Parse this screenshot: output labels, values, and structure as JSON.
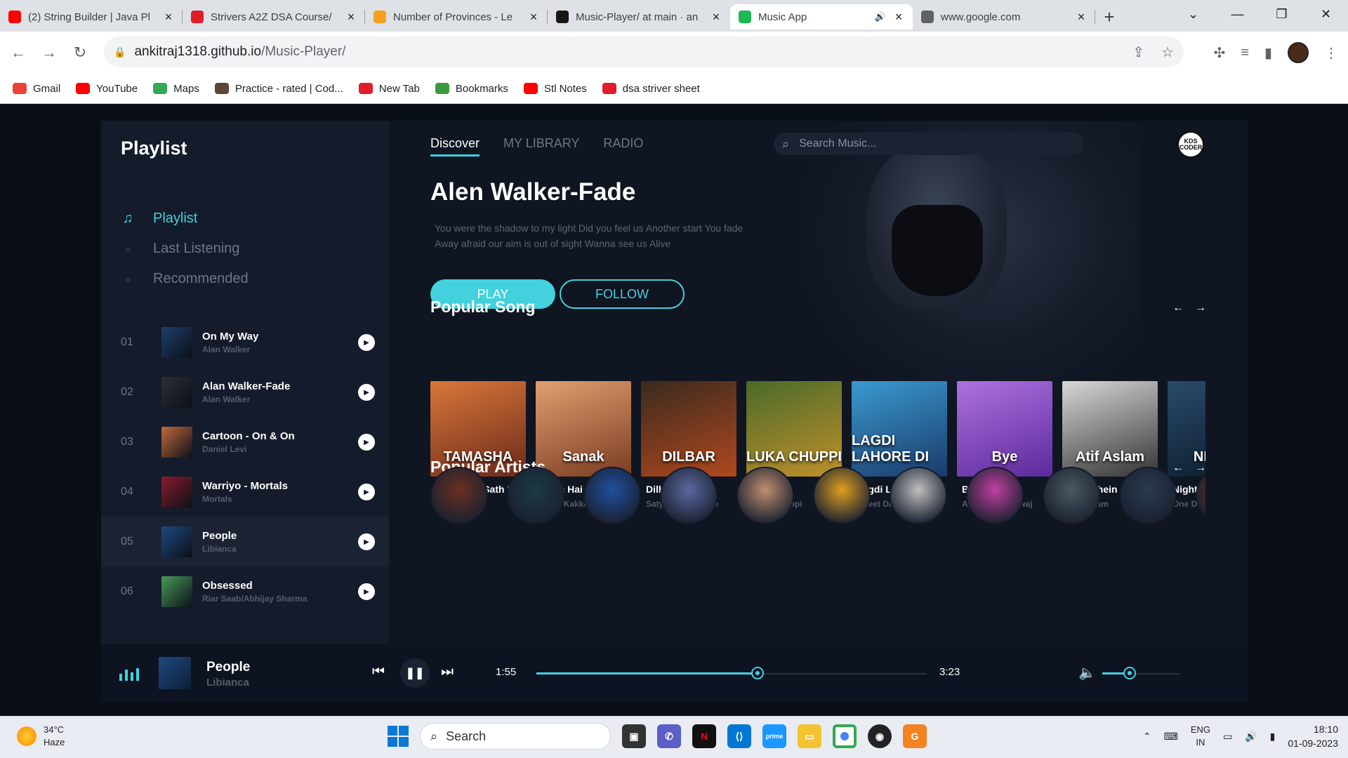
{
  "browser": {
    "tabs": [
      {
        "title": "(2) String Builder | Java Pl",
        "favicon": "youtube-icon",
        "color": "#ff0000",
        "active": false
      },
      {
        "title": "Strivers A2Z DSA Course/",
        "favicon": "tuf-icon",
        "color": "#e11d2a",
        "active": false
      },
      {
        "title": "Number of Provinces - Le",
        "favicon": "leetcode-icon",
        "color": "#f89f1b",
        "active": false
      },
      {
        "title": "Music-Player/ at main · an",
        "favicon": "github-icon",
        "color": "#181717",
        "active": false
      },
      {
        "title": "Music App",
        "favicon": "spotify-icon",
        "color": "#1db954",
        "active": true
      },
      {
        "title": "www.google.com",
        "favicon": "globe-icon",
        "color": "#5f6368",
        "active": false
      }
    ],
    "url_domain": "ankitraj1318.github.io",
    "url_path": "/Music-Player/",
    "bookmarks": [
      {
        "label": "Gmail",
        "icon": "gmail-icon",
        "color": "#ea4335"
      },
      {
        "label": "YouTube",
        "icon": "youtube-icon",
        "color": "#ff0000"
      },
      {
        "label": "Maps",
        "icon": "maps-icon",
        "color": "#34a853"
      },
      {
        "label": "Practice - rated | Cod...",
        "icon": "codechef-icon",
        "color": "#5b4638"
      },
      {
        "label": "New Tab",
        "icon": "tuf-icon",
        "color": "#e11d2a"
      },
      {
        "label": "Bookmarks",
        "icon": "bookmark-4-icon",
        "color": "#3c9a3c"
      },
      {
        "label": "Stl Notes",
        "icon": "youtube-icon",
        "color": "#ff0000"
      },
      {
        "label": "dsa striver sheet",
        "icon": "tuf-icon",
        "color": "#e11d2a"
      }
    ]
  },
  "app": {
    "accent": "#42d1dd",
    "sidebar": {
      "title": "Playlist",
      "nav": [
        {
          "label": "Playlist",
          "active": true,
          "icon": "music-note-icon"
        },
        {
          "label": "Last Listening",
          "active": false,
          "icon": "circle-icon"
        },
        {
          "label": "Recommended",
          "active": false,
          "icon": "circle-icon"
        }
      ],
      "tracks": [
        {
          "num": "01",
          "title": "On My Way",
          "artist": "Alan Walker",
          "art": "#1d3f6b"
        },
        {
          "num": "02",
          "title": "Alan Walker-Fade",
          "artist": "Alan Walker",
          "art": "#2b2f36"
        },
        {
          "num": "03",
          "title": "Cartoon - On & On",
          "artist": "Daniel Levi",
          "art": "#c26a3a"
        },
        {
          "num": "04",
          "title": "Warriyo - Mortals",
          "artist": "Mortals",
          "art": "#8a1c2c"
        },
        {
          "num": "05",
          "title": "People",
          "artist": "Libianca",
          "art": "#1e4a80"
        },
        {
          "num": "06",
          "title": "Obsessed",
          "artist": "Riar Saab/Abhijay Sharma",
          "art": "#4a9a5a"
        }
      ]
    },
    "header": {
      "tabs": [
        "Discover",
        "MY LIBRARY",
        "RADIO"
      ],
      "search_placeholder": "Search Music...",
      "logo_text": "KDS CODER"
    },
    "hero": {
      "title": "Alen Walker-Fade",
      "description": "You were the shadow to my light Did you feel us Another start You fade Away afraid our aim is out of sight Wanna see us Alive",
      "play_label": "PLAY",
      "follow_label": "FOLLOW"
    },
    "popular_songs": {
      "title": "Popular Song",
      "items": [
        {
          "title": "Agar Tum Sath Ho",
          "artist": "Tamashaa",
          "cover_text": "TAMASHA",
          "c1": "#d9773a",
          "c2": "#6b2a1a"
        },
        {
          "title": "Suna Hai",
          "artist": "Neha Kakker",
          "cover_text": "Sanak",
          "c1": "#e0a070",
          "c2": "#7a3b22"
        },
        {
          "title": "Dilber",
          "artist": "Satyameva Jayate",
          "cover_text": "DILBAR",
          "c1": "#3a2a1e",
          "c2": "#b0481e"
        },
        {
          "title": "Duniya",
          "artist": "Luka Chuppi",
          "cover_text": "LUKA CHUPPI",
          "c1": "#4a6a2a",
          "c2": "#c0902a"
        },
        {
          "title": "Lagdi Lahore Di",
          "artist": "Street Dancer 3D",
          "cover_text": "LAGDI LAHORE DI",
          "c1": "#3a9ad0",
          "c2": "#1a3a6a"
        },
        {
          "title": "Bye Bye",
          "artist": "Aditya Bharadwaj",
          "cover_text": "Bye",
          "c1": "#b070e0",
          "c2": "#5a2a9a"
        },
        {
          "title": "Baarishein",
          "artist": "Atif Aslam",
          "cover_text": "Atif Aslam",
          "c1": "#d8d8d8",
          "c2": "#333"
        },
        {
          "title": "Night C",
          "artist": "One Dir",
          "cover_text": "NIGHT",
          "c1": "#2a4a6a",
          "c2": "#0a1a2a"
        }
      ]
    },
    "popular_artists": {
      "title": "Popular Artists",
      "items": [
        {
          "name": "artist-1",
          "color": "#6a3020"
        },
        {
          "name": "artist-2",
          "color": "#1a3a44"
        },
        {
          "name": "artist-3",
          "color": "#2050a0"
        },
        {
          "name": "artist-4",
          "color": "#5a6aa0"
        },
        {
          "name": "artist-5",
          "color": "#c09070"
        },
        {
          "name": "artist-6",
          "color": "#e0a020"
        },
        {
          "name": "artist-7",
          "color": "#c0c0c0"
        },
        {
          "name": "artist-8",
          "color": "#c040a0"
        },
        {
          "name": "artist-9",
          "color": "#4a5a60"
        },
        {
          "name": "artist-10",
          "color": "#2a3a50"
        },
        {
          "name": "artist-11",
          "color": "#6a3020"
        }
      ]
    },
    "player": {
      "title": "People",
      "artist": "Libianca",
      "current_time": "1:55",
      "total_time": "3:23",
      "progress": 0.566,
      "volume": 0.35
    }
  },
  "taskbar": {
    "temp": "34°C",
    "weather": "Haze",
    "search_label": "Search",
    "lang": "ENG",
    "region": "IN",
    "time": "18:10",
    "date": "01-09-2023"
  }
}
